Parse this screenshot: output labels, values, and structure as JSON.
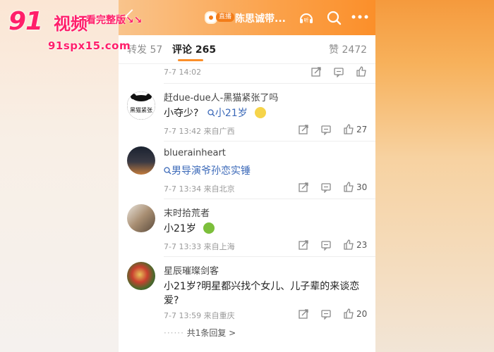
{
  "watermark": {
    "brand": "91",
    "site": "视频",
    "promo": "看完整版",
    "promo_arrows": "↘↘",
    "domain": "91spx15.com"
  },
  "header": {
    "live_tag": "直播",
    "channel_name": "陈思诚带...",
    "icons": [
      "back-icon",
      "listen-icon",
      "search-icon",
      "more-icon"
    ],
    "listen_label": "听"
  },
  "tabs": [
    {
      "label": "转发",
      "count": "57"
    },
    {
      "label": "评论",
      "count": "265"
    },
    {
      "label": "赞",
      "count": "2472"
    }
  ],
  "first_comment_meta": "7-7 14:02",
  "comments": [
    {
      "username": "赶due-due人-黑猫紧张了吗",
      "avatar_text": "黑猫紧张",
      "text": "小夺少?",
      "link": "小21岁",
      "meta": "7-7 13:42  来自广西",
      "likes": "27"
    },
    {
      "username": "bluerainheart",
      "link": "男导演爷孙恋实锤",
      "meta": "7-7 13:34  来自北京",
      "likes": "30"
    },
    {
      "username": "末时拾荒者",
      "text": "小21岁",
      "meta": "7-7 13:33  来自上海",
      "likes": "23"
    },
    {
      "username": "星辰璀璨剑客",
      "text_line1": "小21岁?明星都兴找个女儿、儿子辈的来谈恋",
      "text_line2": "爱?",
      "meta": "7-7 13:59  来自重庆",
      "likes": "20",
      "replies": "共1条回复 >"
    }
  ],
  "colors": {
    "accent": "#fb8f2a",
    "link": "#3a68b8",
    "watermark": "#ff1f6a"
  }
}
